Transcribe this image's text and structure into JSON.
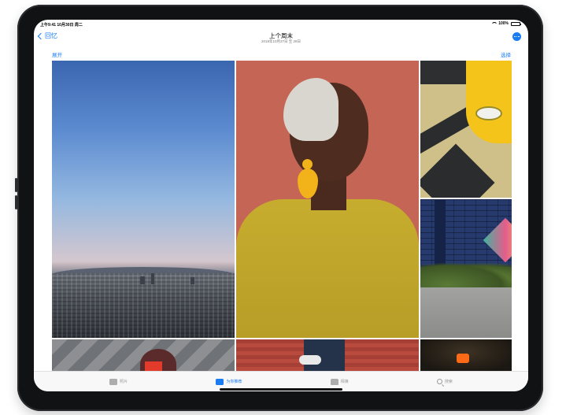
{
  "status_bar": {
    "time": "上午9:41  10月30日 周二",
    "battery": "100%"
  },
  "nav": {
    "back_label": "回忆",
    "title": "上个周末",
    "subtitle": "2018年10月27日 至 28日"
  },
  "links": {
    "expand": "展开",
    "select": "选择"
  },
  "tabs": [
    {
      "label": "照片",
      "icon": "photos-icon",
      "active": false
    },
    {
      "label": "为你推荐",
      "icon": "for-you-icon",
      "active": true
    },
    {
      "label": "相簿",
      "icon": "albums-icon",
      "active": false
    },
    {
      "label": "搜索",
      "icon": "search-icon",
      "active": false
    }
  ],
  "colors": {
    "accent": "#1a7cf5"
  }
}
